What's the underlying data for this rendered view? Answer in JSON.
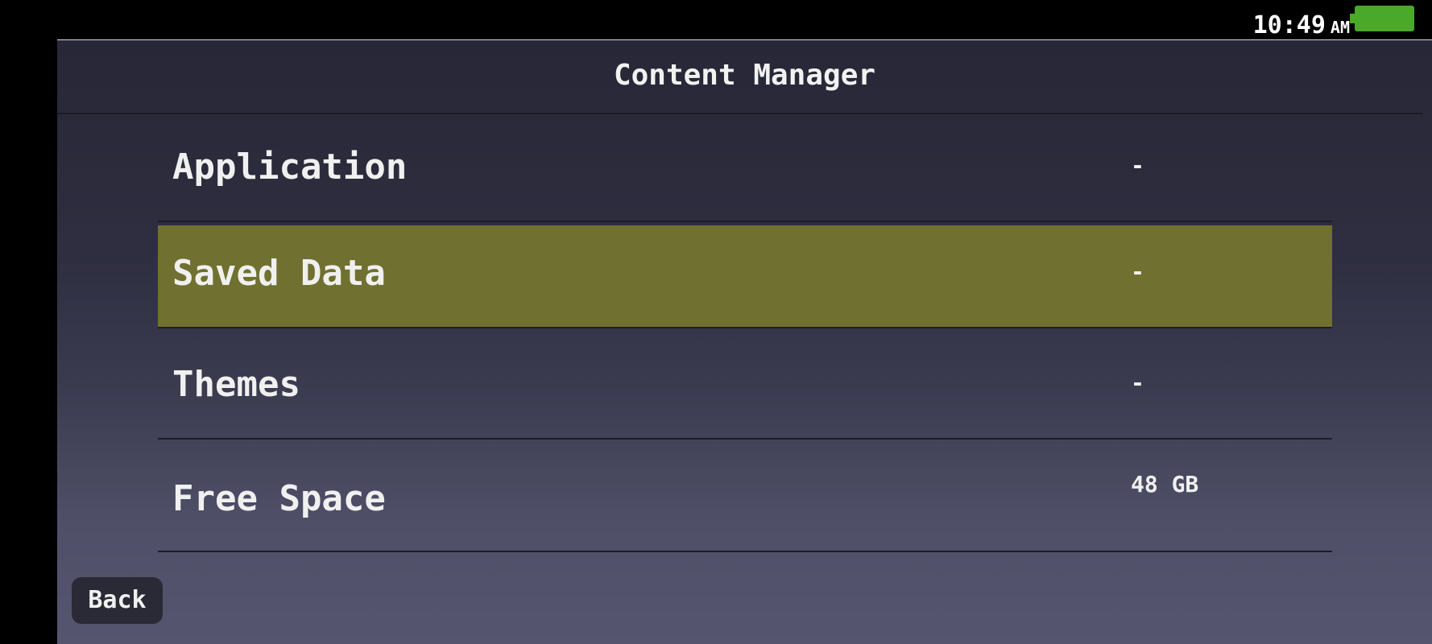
{
  "status_bar": {
    "time": "10:49",
    "ampm": "AM",
    "battery_color": "#4aa82a"
  },
  "header": {
    "title": "Content Manager"
  },
  "menu": {
    "items": [
      {
        "label": "Application",
        "value": "-",
        "selected": false
      },
      {
        "label": "Saved Data",
        "value": "-",
        "selected": true
      },
      {
        "label": "Themes",
        "value": "-",
        "selected": false
      },
      {
        "label": "Free Space",
        "value": "48 GB",
        "selected": false
      }
    ]
  },
  "footer": {
    "back_label": "Back"
  },
  "colors": {
    "selected_row": "#707030",
    "background_top": "#272737",
    "background_bottom": "#555570"
  }
}
